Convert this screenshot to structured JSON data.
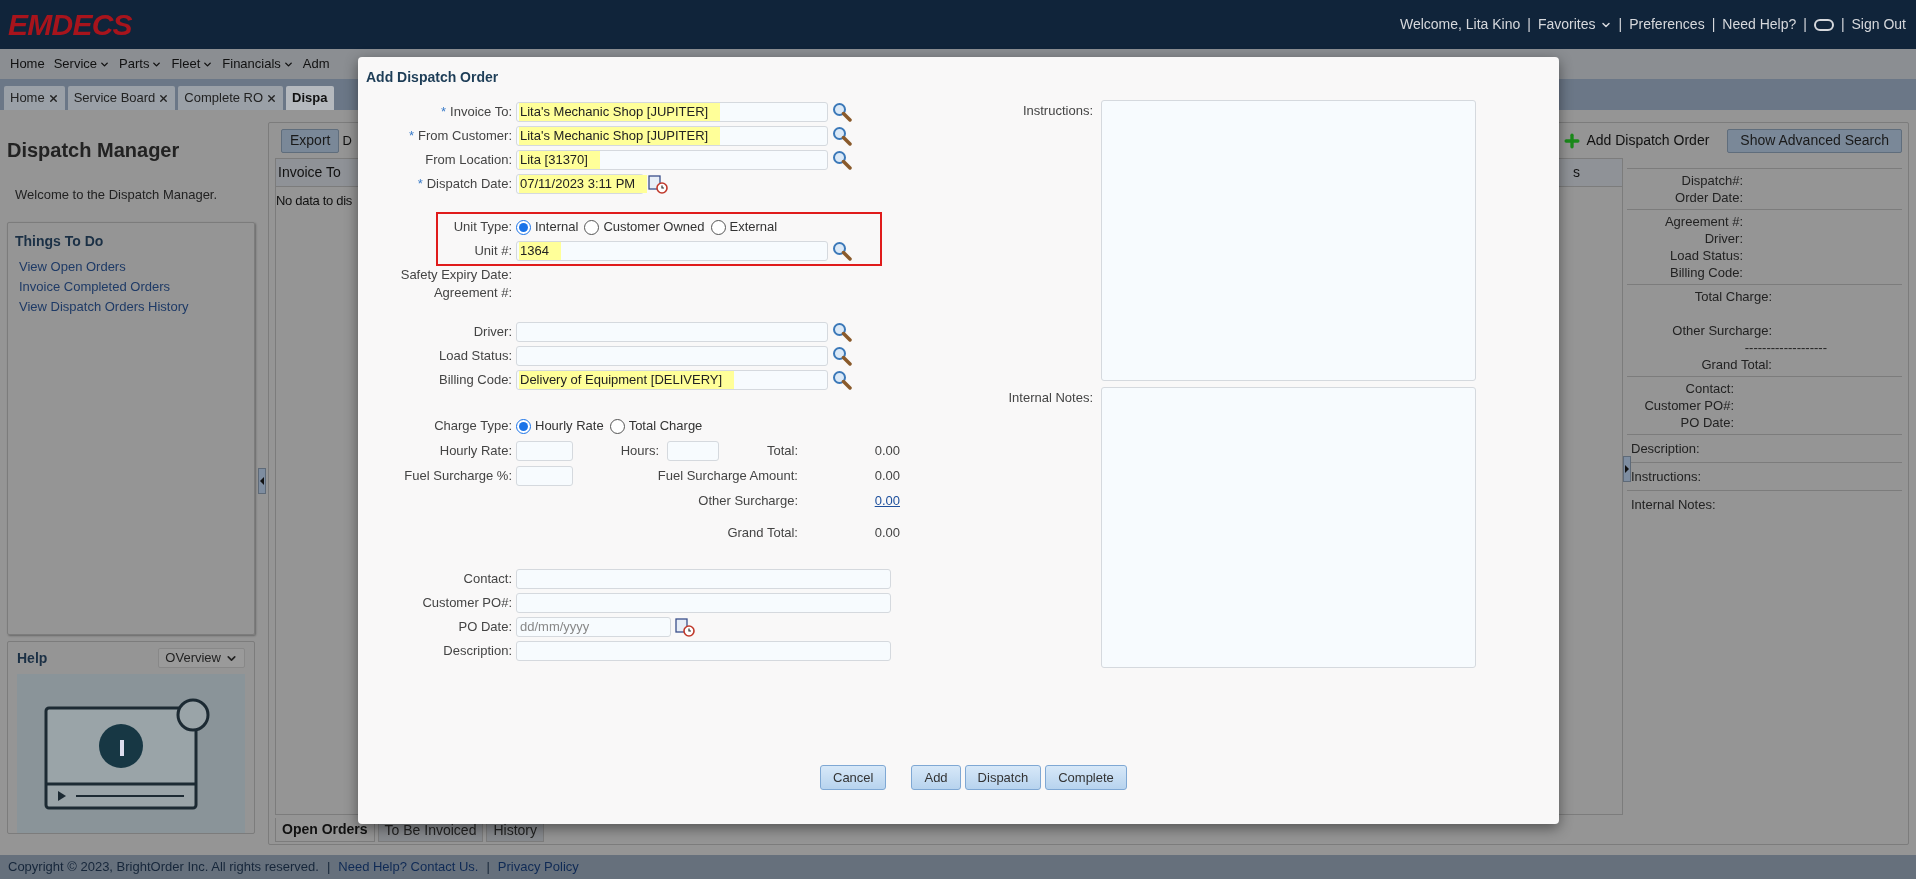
{
  "header": {
    "logo": "EMDECS",
    "separator": "|",
    "items": [
      {
        "kind": "text",
        "text": "Welcome, Lita Kino"
      },
      {
        "kind": "menu",
        "text": "Favorites"
      },
      {
        "kind": "link",
        "text": "Preferences"
      },
      {
        "kind": "link",
        "text": "Need Help?"
      },
      {
        "kind": "toggle"
      },
      {
        "kind": "link",
        "text": "Sign Out"
      }
    ]
  },
  "menu": [
    {
      "label": "Home",
      "dropdown": false
    },
    {
      "label": "Service",
      "dropdown": true
    },
    {
      "label": "Parts",
      "dropdown": true
    },
    {
      "label": "Fleet",
      "dropdown": true
    },
    {
      "label": "Financials",
      "dropdown": true
    },
    {
      "label": "Adm",
      "dropdown": false
    }
  ],
  "tabs": [
    {
      "label": "Home",
      "selected": false,
      "closable": true
    },
    {
      "label": "Service Board",
      "selected": false,
      "closable": true
    },
    {
      "label": "Complete RO",
      "selected": false,
      "closable": true
    },
    {
      "label": "Dispa",
      "selected": true,
      "closable": false
    }
  ],
  "sidebar": {
    "title": "Dispatch Manager",
    "welcome": "Welcome to the Dispatch Manager.",
    "things_to_do": {
      "title": "Things To Do",
      "links": [
        "View Open Orders",
        "Invoice Completed Orders",
        "View Dispatch Orders History"
      ]
    },
    "help": {
      "title": "Help",
      "select": "OVerview"
    }
  },
  "toolbar": {
    "export": "Export",
    "cut_text": "D",
    "add": "Add Dispatch Order",
    "advanced": "Show Advanced Search"
  },
  "grid": {
    "columns": [
      "Invoice To",
      "s"
    ],
    "empty": "No data to dis"
  },
  "bottom_tabs": [
    {
      "label": "Open Orders",
      "selected": true
    },
    {
      "label": "To Be Invoiced",
      "selected": false
    },
    {
      "label": "History",
      "selected": false
    }
  ],
  "details": {
    "summary_groups": [
      [
        "Dispatch#:",
        "Order Date:"
      ],
      [
        "Agreement #:",
        "Driver:",
        "Load Status:",
        "Billing Code:"
      ],
      [
        "Total Charge:",
        "Other Surcharge:",
        "-------------------",
        "Grand Total:"
      ],
      [
        "Contact:",
        "Customer PO#:",
        "PO Date:"
      ]
    ],
    "sections": [
      "Description:",
      "Instructions:",
      "Internal Notes:"
    ]
  },
  "footer": {
    "copyright": "Copyright © 2023, BrightOrder Inc. All rights reserved.",
    "separator": "|",
    "links": [
      "Need Help? Contact Us.",
      "Privacy Policy"
    ]
  },
  "dialog": {
    "title": "Add Dispatch Order",
    "required_mark": "*",
    "sections": [
      {
        "outlined": false,
        "rows": [
          {
            "kind": "lookup",
            "label": "Invoice To:",
            "required": true,
            "value": "Lita's Mechanic Shop [JUPITER]"
          },
          {
            "kind": "lookup",
            "label": "From Customer:",
            "required": true,
            "value": "Lita's Mechanic Shop [JUPITER]"
          },
          {
            "kind": "lookup",
            "label": "From Location:",
            "required": false,
            "value": "Lita [31370]"
          },
          {
            "kind": "date",
            "label": "Dispatch Date:",
            "required": true,
            "value": "07/11/2023 3:11 PM"
          }
        ]
      },
      {
        "outlined": true,
        "rows": [
          {
            "kind": "radio",
            "label": "Unit Type:",
            "required": false,
            "options": [
              {
                "label": "Internal",
                "selected": true
              },
              {
                "label": "Customer Owned",
                "selected": false
              },
              {
                "label": "External",
                "selected": false
              }
            ]
          },
          {
            "kind": "lookup",
            "label": "Unit #:",
            "required": false,
            "value": "1364"
          }
        ]
      },
      {
        "outlined": false,
        "rows": [
          {
            "kind": "static",
            "label": "Safety Expiry Date:",
            "required": false
          },
          {
            "kind": "static",
            "label": "Agreement #:",
            "required": false
          }
        ]
      },
      {
        "outlined": false,
        "rows": [
          {
            "kind": "lookup",
            "label": "Driver:",
            "required": false
          },
          {
            "kind": "lookup",
            "label": "Load Status:",
            "required": false
          },
          {
            "kind": "lookup",
            "label": "Billing Code:",
            "required": false,
            "value": "Delivery of Equipment [DELIVERY]"
          }
        ]
      }
    ],
    "charge_type": {
      "label": "Charge Type:",
      "options": [
        {
          "label": "Hourly Rate",
          "selected": true
        },
        {
          "label": "Total Charge",
          "selected": false
        }
      ]
    },
    "charges": {
      "hourly_rate": "Hourly Rate:",
      "hours": "Hours:",
      "total": {
        "label": "Total:",
        "value": "0.00"
      },
      "fuel_pct": "Fuel Surcharge %:",
      "fuel_amount": {
        "label": "Fuel Surcharge Amount:",
        "value": "0.00"
      },
      "other": {
        "label": "Other Surcharge:",
        "value": "0.00"
      },
      "grand_total": {
        "label": "Grand Total:",
        "value": "0.00"
      }
    },
    "contact_rows": [
      {
        "kind": "text",
        "label": "Contact:"
      },
      {
        "kind": "text",
        "label": "Customer PO#:"
      },
      {
        "kind": "date",
        "label": "PO Date:",
        "placeholder": "dd/mm/yyyy"
      },
      {
        "kind": "text",
        "label": "Description:"
      }
    ],
    "notes": [
      {
        "label": "Instructions:"
      },
      {
        "label": "Internal Notes:"
      }
    ],
    "buttons": [
      {
        "kind": "cancel",
        "label": "Cancel"
      },
      {
        "kind": "action",
        "label": "Add"
      },
      {
        "kind": "action",
        "label": "Dispatch"
      },
      {
        "kind": "action",
        "label": "Complete"
      }
    ]
  }
}
